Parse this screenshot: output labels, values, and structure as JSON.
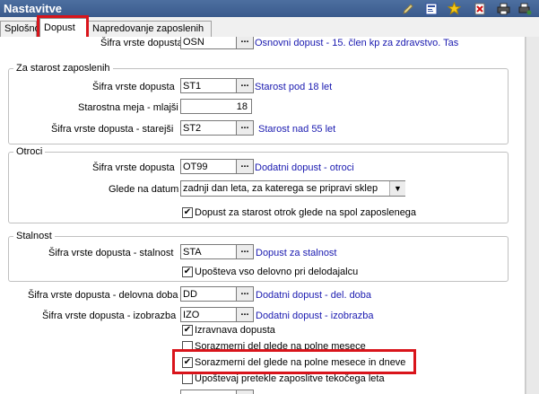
{
  "window": {
    "title": "Nastavitve"
  },
  "toolbar": {
    "icons": [
      "edit-icon",
      "form-icon",
      "star-icon",
      "delete-icon",
      "print-icon",
      "printer-settings-icon"
    ]
  },
  "tabs": [
    {
      "label": "Splošno"
    },
    {
      "label": "Dopust"
    },
    {
      "label": "Napredovanje zaposlenih"
    }
  ],
  "top_row": {
    "label": "Šifra vrste dopusta",
    "value": "OSN",
    "desc": "Osnovni dopust - 15. člen kp za zdravstvo. Tas"
  },
  "age_group": {
    "title": "Za starost zaposlenih",
    "code_label": "Šifra vrste dopusta",
    "code_value": "ST1",
    "code_desc": "Starost pod 18 let",
    "limit_label": "Starostna meja - mlajši",
    "limit_value": "18",
    "older_label": "Šifra vrste dopusta - starejši",
    "older_value": "ST2",
    "older_desc": "Starost nad 55 let"
  },
  "children_group": {
    "title": "Otroci",
    "code_label": "Šifra vrste dopusta",
    "code_value": "OT99",
    "code_desc": "Dodatni dopust - otroci",
    "date_label": "Glede na datum",
    "date_value": "zadnji dan leta, za katerega se pripravi sklep",
    "check_label": "Dopust za starost otrok glede na spol zaposlenega"
  },
  "tenure_group": {
    "title": "Stalnost",
    "code_label": "Šifra vrste dopusta - stalnost",
    "code_value": "STA",
    "code_desc": "Dopust za stalnost",
    "check_label": "Upošteva vso delovno pri delodajalcu"
  },
  "work_row": {
    "label": "Šifra vrste dopusta - delovna doba",
    "value": "DD",
    "desc": "Dodatni dopust - del. doba"
  },
  "edu_row": {
    "label": "Šifra vrste dopusta - izobrazba",
    "value": "IZO",
    "desc": "Dodatni dopust - izobrazba"
  },
  "checks": [
    {
      "label": "Izravnava dopusta",
      "checked": true
    },
    {
      "label": "Sorazmerni del glede na polne mesece",
      "checked": false
    },
    {
      "label": "Sorazmerni del glede na polne mesece in dneve",
      "checked": true
    },
    {
      "label": "Upoštevaj pretekle zaposlitve tekočega leta",
      "checked": false
    }
  ],
  "ellipsis": "...",
  "highlight_color": "#d9141b"
}
